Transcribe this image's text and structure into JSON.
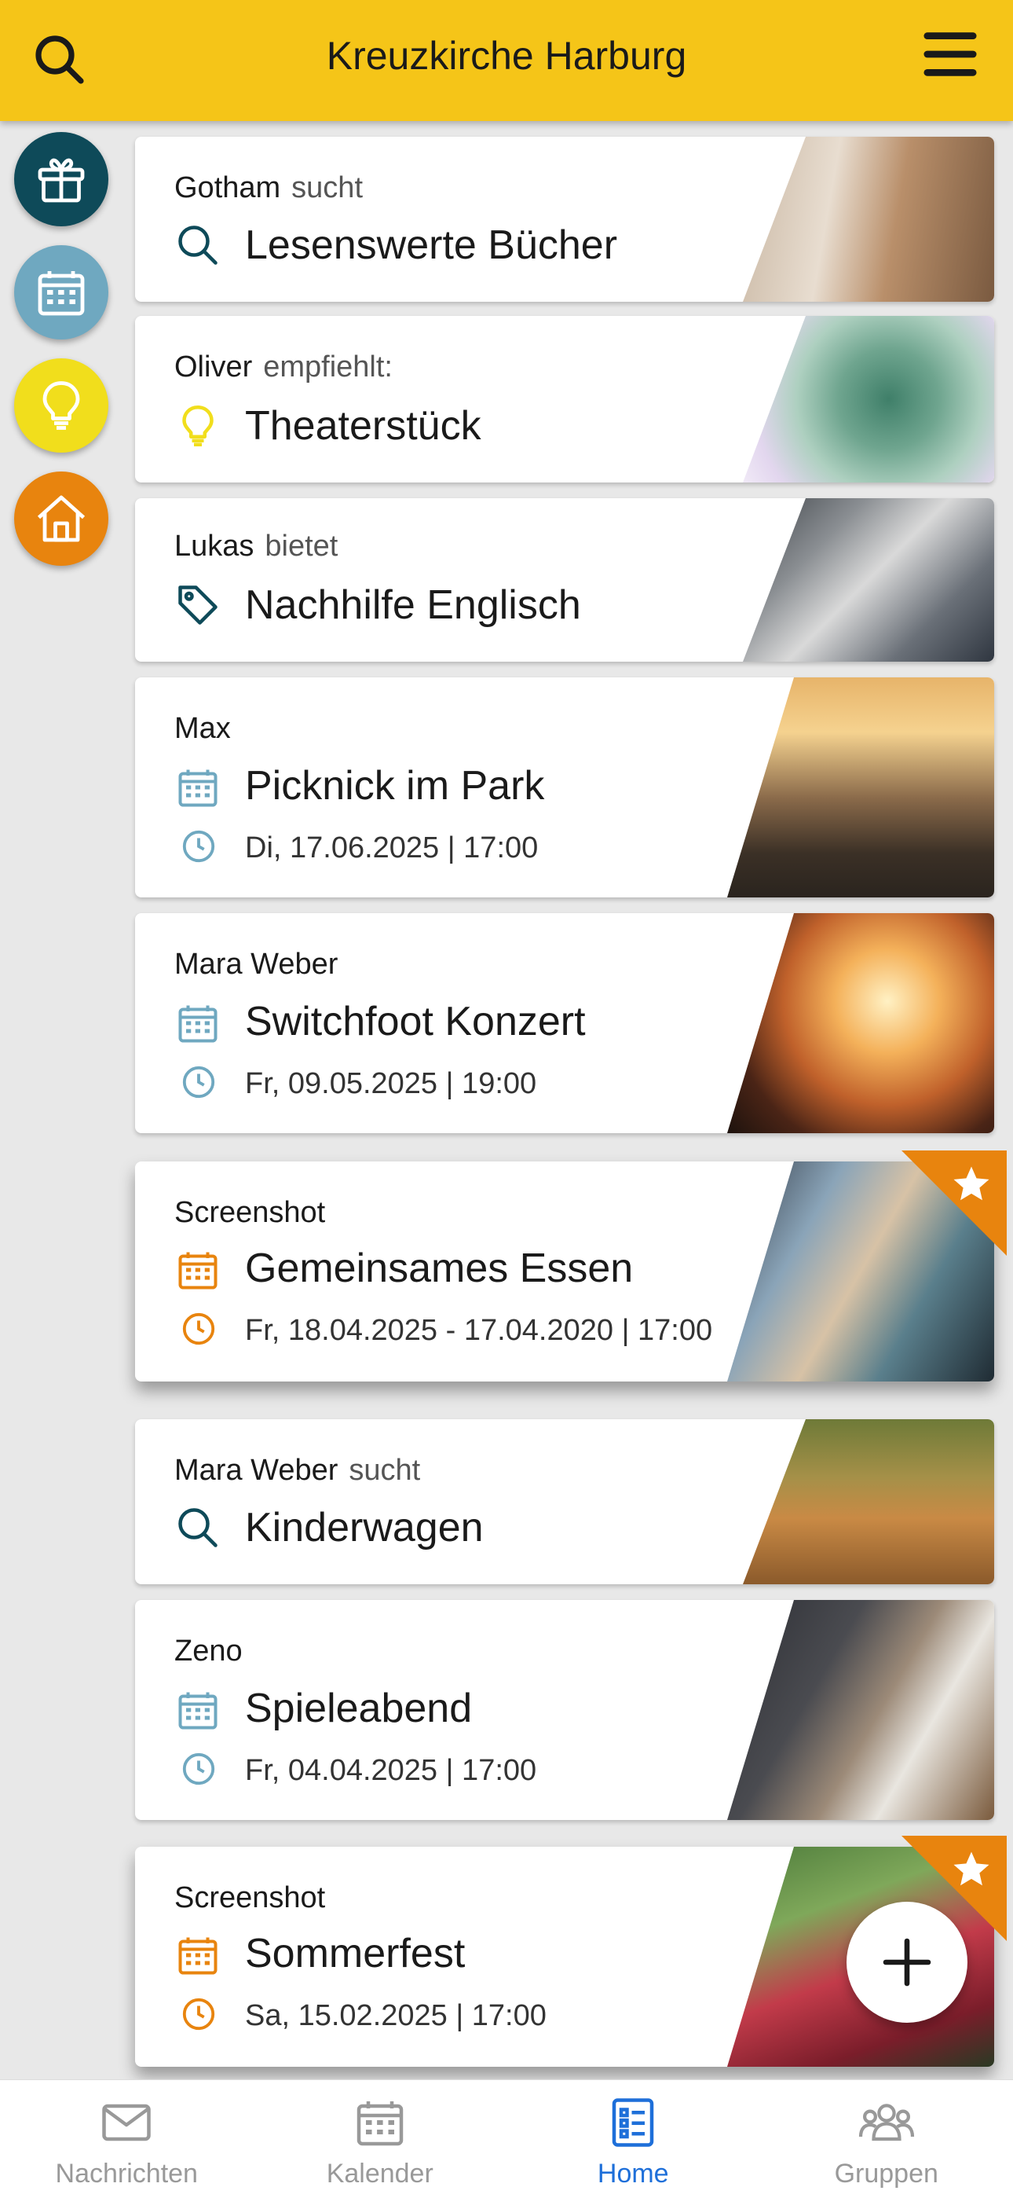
{
  "header": {
    "title": "Kreuzkirche Harburg",
    "search_icon": "search-icon",
    "menu_icon": "hamburger-menu-icon"
  },
  "side_buttons": [
    {
      "icon": "gift-icon",
      "color": "#0e4a59"
    },
    {
      "icon": "calendar-icon",
      "color": "#6fa8c0"
    },
    {
      "icon": "lightbulb-icon",
      "color": "#f1de1c"
    },
    {
      "icon": "home-icon",
      "color": "#e8840e"
    }
  ],
  "cards": [
    {
      "author": "Gotham",
      "verb": "sucht",
      "title": "Lesenswerte Bücher",
      "icon": "search-icon"
    },
    {
      "author": "Oliver",
      "verb": "empfiehlt:",
      "title": "Theaterstück",
      "icon": "lightbulb-icon"
    },
    {
      "author": "Lukas",
      "verb": "bietet",
      "title": "Nachhilfe Englisch",
      "icon": "tag-icon"
    },
    {
      "author": "Max",
      "title": "Picknick im Park",
      "date": "Di, 17.06.2025 | 17:00",
      "icon": "calendar-icon"
    },
    {
      "author": "Mara Weber",
      "title": "Switchfoot Konzert",
      "date": "Fr, 09.05.2025 | 19:00",
      "icon": "calendar-icon"
    },
    {
      "author": "Screenshot",
      "title": "Gemeinsames Essen",
      "date": "Fr, 18.04.2025 - 17.04.2020 | 17:00",
      "icon": "calendar-icon",
      "featured": true
    },
    {
      "author": "Mara Weber",
      "verb": "sucht",
      "title": "Kinderwagen",
      "icon": "search-icon"
    },
    {
      "author": "Zeno",
      "title": "Spieleabend",
      "date": "Fr, 04.04.2025 | 17:00",
      "icon": "calendar-icon"
    },
    {
      "author": "Screenshot",
      "title": "Sommerfest",
      "date": "Sa, 15.02.2025 | 17:00",
      "icon": "calendar-icon",
      "featured": true
    }
  ],
  "fab": {
    "icon": "plus-icon"
  },
  "bottom_nav": [
    {
      "label": "Nachrichten",
      "icon": "envelope-icon"
    },
    {
      "label": "Kalender",
      "icon": "calendar-icon"
    },
    {
      "label": "Home",
      "icon": "list-icon",
      "active": true
    },
    {
      "label": "Gruppen",
      "icon": "group-icon"
    }
  ],
  "colors": {
    "header": "#f5c518",
    "accent_orange": "#e8840e",
    "icon_teal": "#6fa8c0",
    "icon_dark": "#0e4a59",
    "active_nav": "#1e6fd9"
  }
}
